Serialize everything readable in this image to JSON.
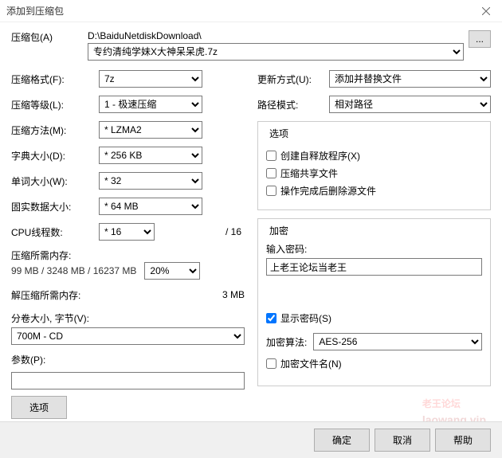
{
  "window": {
    "title": "添加到压缩包"
  },
  "archive": {
    "label": "压缩包(A)",
    "path": "D:\\BaiduNetdiskDownload\\",
    "name": "专约清纯学妹X大神呆呆虎.7z",
    "browse": "..."
  },
  "left": {
    "format": {
      "label": "压缩格式(F):",
      "value": "7z"
    },
    "level": {
      "label": "压缩等级(L):",
      "value": "1 - 极速压缩"
    },
    "method": {
      "label": "压缩方法(M):",
      "value": "* LZMA2"
    },
    "dict": {
      "label": "字典大小(D):",
      "value": "* 256 KB"
    },
    "word": {
      "label": "单词大小(W):",
      "value": "* 32"
    },
    "solid": {
      "label": "固实数据大小:",
      "value": "* 64 MB"
    },
    "cpu": {
      "label": "CPU线程数:",
      "value": "* 16",
      "total": "/ 16"
    },
    "mem_comp": {
      "label": "压缩所需内存:",
      "value": "99 MB / 3248 MB / 16237 MB"
    },
    "mem_pct": "20%",
    "mem_decomp": {
      "label": "解压缩所需内存:",
      "value": "3 MB"
    },
    "split": {
      "label": "分卷大小, 字节(V):",
      "value": "700M - CD"
    },
    "params": {
      "label": "参数(P):",
      "value": ""
    },
    "options_btn": "选项"
  },
  "right": {
    "update": {
      "label": "更新方式(U):",
      "value": "添加并替换文件"
    },
    "pathmode": {
      "label": "路径模式:",
      "value": "相对路径"
    },
    "options": {
      "legend": "选项",
      "sfx": "创建自释放程序(X)",
      "shared": "压缩共享文件",
      "delete": "操作完成后删除源文件"
    },
    "encrypt": {
      "legend": "加密",
      "pwd_label": "输入密码:",
      "pwd_value": "上老王论坛当老王",
      "show_pwd": "显示密码(S)",
      "algo_label": "加密算法:",
      "algo_value": "AES-256",
      "encnames": "加密文件名(N)"
    }
  },
  "buttons": {
    "ok": "确定",
    "cancel": "取消",
    "help": "帮助"
  },
  "watermark": {
    "main": "老王论坛",
    "sub": "laowang.vip"
  }
}
